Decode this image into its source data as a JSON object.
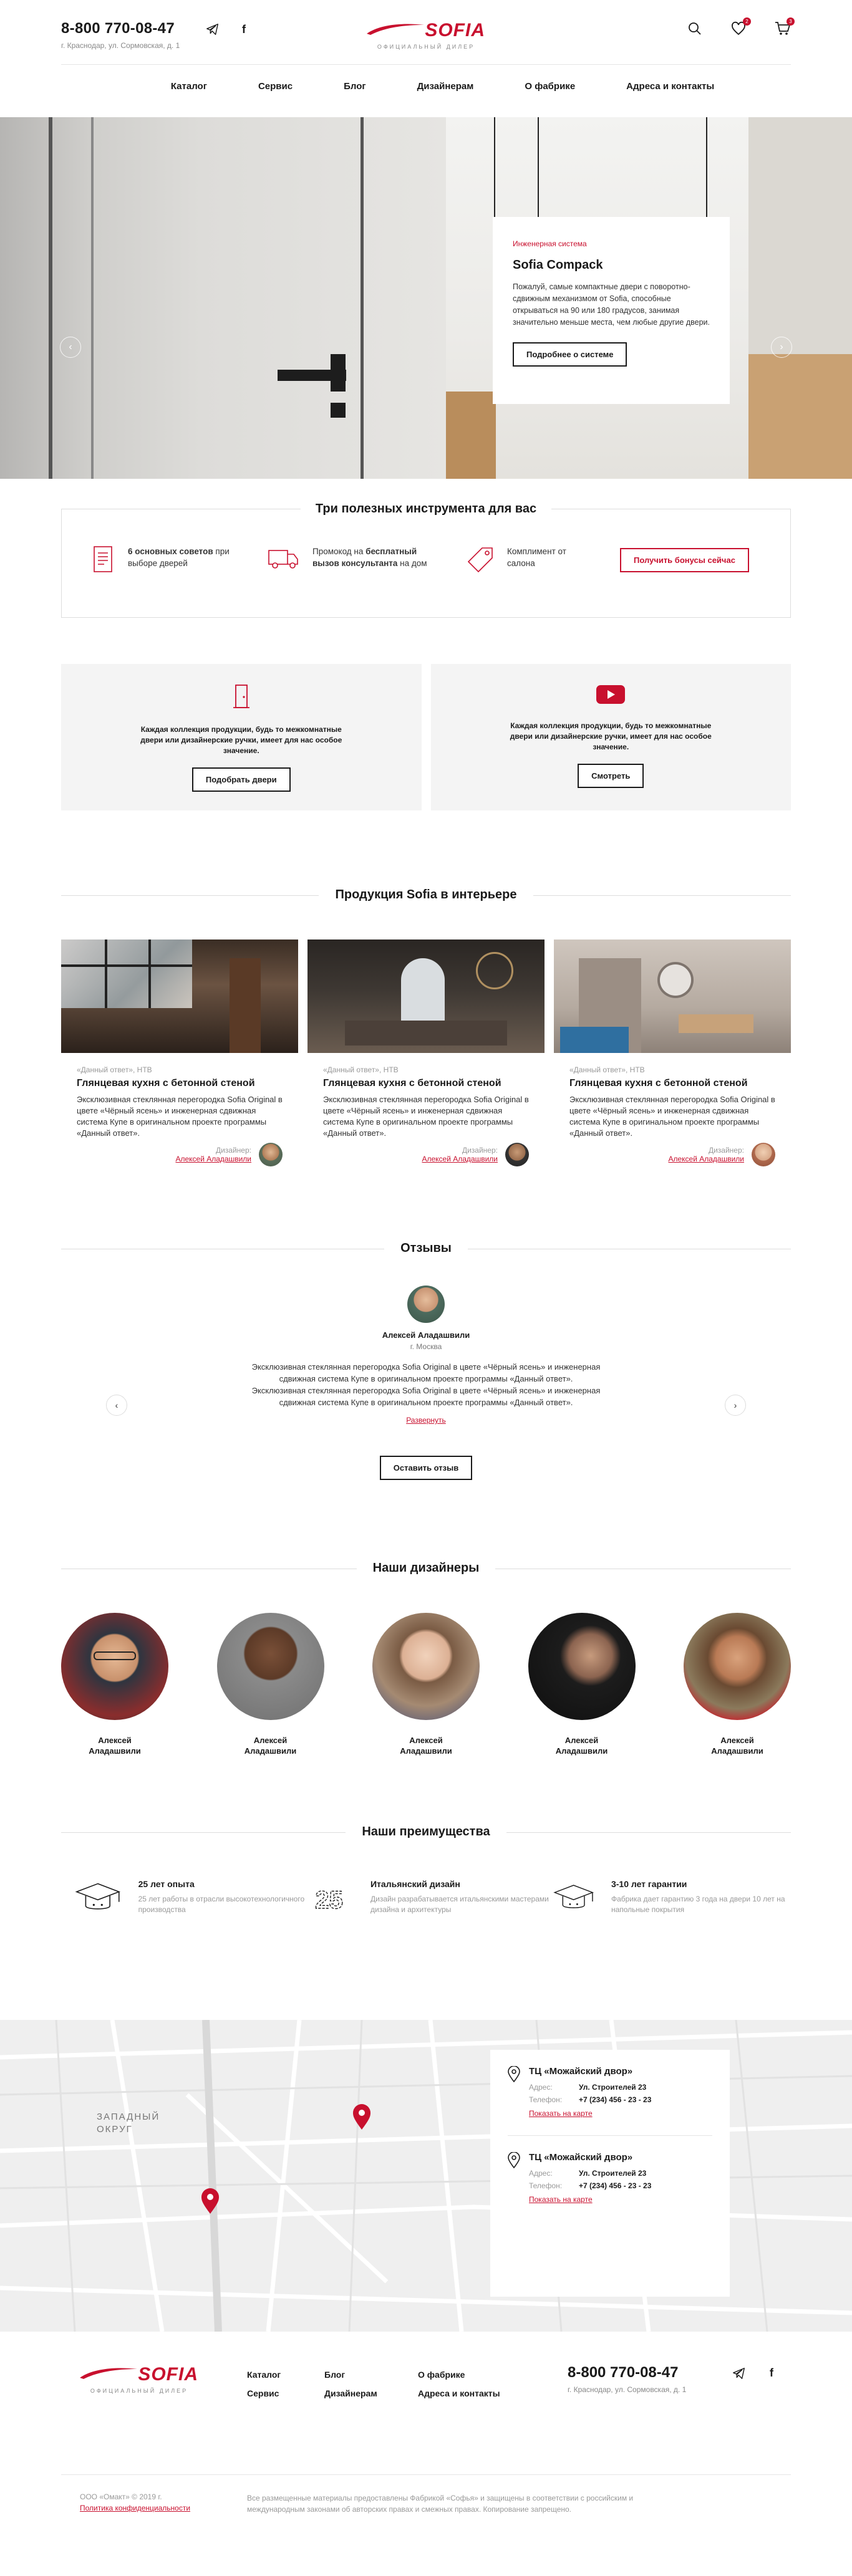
{
  "header": {
    "phone": "8-800 770-08-47",
    "address": "г. Краснодар, ул. Сормовская, д. 1",
    "logo_word": "SOFIA",
    "logo_sub": "ОФИЦИАЛЬНЫЙ ДИЛЕР",
    "wishlist_count": "2",
    "cart_count": "3",
    "nav": [
      "Каталог",
      "Сервис",
      "Блог",
      "Дизайнерам",
      "О фабрике",
      "Адреса и контакты"
    ]
  },
  "hero": {
    "kicker": "Инженерная система",
    "title": "Sofia Compack",
    "text": "Пожалуй, самые компактные двери с поворотно-сдвижным механизмом от Sofia, способные открываться на 90 или 180 градусов, занимая значительно меньше места, чем любые другие двери.",
    "button": "Подробнее о системе"
  },
  "tools": {
    "title": "Три полезных инструмента для вас",
    "t1_bold": "6 основных советов",
    "t1_text": " при выборе дверей",
    "t2_pre": "Промокод на ",
    "t2_bold": "бесплатный вызов консультанта",
    "t2_post": " на дом",
    "t3": "Комплимент от салона",
    "button": "Получить бонусы сейчас"
  },
  "promo_boxes": [
    {
      "text": "Каждая коллекция продукции, будь то межкомнатные двери или дизайнерские ручки, имеет для нас особое значение.",
      "button": "Подобрать двери"
    },
    {
      "text": "Каждая коллекция продукции, будь то межкомнатные двери или дизайнерские ручки, имеет для нас особое значение.",
      "button": "Смотреть"
    }
  ],
  "products": {
    "title": "Продукция Sofia в интерьере",
    "items": [
      {
        "tag": "«Данный ответ», НТВ",
        "title": "Глянцевая кухня с бетонной стеной",
        "text": "Эксклюзивная стеклянная перегородка Sofia Original в цвете «Чёрный ясень» и инженерная сдвижная система Купе в оригинальном проекте программы «Данный ответ».",
        "designer_label": "Дизайнер:",
        "designer": "Алексей Аладашвили"
      },
      {
        "tag": "«Данный ответ», НТВ",
        "title": "Глянцевая кухня с бетонной стеной",
        "text": "Эксклюзивная стеклянная перегородка Sofia Original в цвете «Чёрный ясень» и инженерная сдвижная система Купе в оригинальном проекте программы «Данный ответ».",
        "designer_label": "Дизайнер:",
        "designer": "Алексей Аладашвили"
      },
      {
        "tag": "«Данный ответ», НТВ",
        "title": "Глянцевая кухня с бетонной стеной",
        "text": "Эксклюзивная стеклянная перегородка Sofia Original в цвете «Чёрный ясень» и инженерная сдвижная система Купе в оригинальном проекте программы «Данный ответ».",
        "designer_label": "Дизайнер:",
        "designer": "Алексей Аладашвили"
      }
    ]
  },
  "reviews": {
    "title": "Отзывы",
    "name": "Алексей Аладашвили",
    "city": "г. Москва",
    "text": "Эксклюзивная стеклянная перегородка Sofia Original в цвете «Чёрный ясень» и инженерная сдвижная система Купе в оригинальном проекте программы «Данный ответ». Эксклюзивная стеклянная перегородка Sofia Original в цвете «Чёрный ясень» и инженерная сдвижная система Купе в оригинальном проекте программы «Данный ответ».",
    "more": "Развернуть",
    "button": "Оставить отзыв"
  },
  "designers": {
    "title": "Наши дизайнеры",
    "items": [
      {
        "first": "Алексей",
        "last": "Аладашвили"
      },
      {
        "first": "Алексей",
        "last": "Аладашвили"
      },
      {
        "first": "Алексей",
        "last": "Аладашвили"
      },
      {
        "first": "Алексей",
        "last": "Аладашвили"
      },
      {
        "first": "Алексей",
        "last": "Аладашвили"
      }
    ]
  },
  "advantages": {
    "title": "Наши преимущества",
    "items": [
      {
        "title": "25 лет опыта",
        "text": "25 лет работы в отрасли высокотехнологичного производства"
      },
      {
        "title": "Итальянский дизайн",
        "text": "Дизайн разрабатывается итальянскими мастерами дизайна и архитектуры"
      },
      {
        "title": "3-10 лет гарантии",
        "text": "Фабрика дает гарантию 3 года на двери 10 лет на напольные покрытия"
      }
    ]
  },
  "map": {
    "district": "ЗАПАДНЫЙ ОКРУГ",
    "locations": [
      {
        "name": "ТЦ «Можайский двор»",
        "addr_label": "Адрес:",
        "addr": "Ул. Строителей 23",
        "tel_label": "Телефон:",
        "tel": "+7 (234) 456 - 23 - 23",
        "link": "Показать на карте"
      },
      {
        "name": "ТЦ «Можайский двор»",
        "addr_label": "Адрес:",
        "addr": "Ул. Строителей 23",
        "tel_label": "Телефон:",
        "tel": "+7 (234) 456 - 23 - 23",
        "link": "Показать на карте"
      }
    ]
  },
  "footer": {
    "col1": [
      "Каталог",
      "Сервис"
    ],
    "col2": [
      "Блог",
      "Дизайнерам"
    ],
    "col3": [
      "О фабрике",
      "Адреса и контакты"
    ],
    "phone": "8-800 770-08-47",
    "address": "г. Краснодар, ул. Сормовская, д. 1",
    "copyright": "ООО «Омакт» © 2019 г.",
    "privacy": "Политика конфиденциальности",
    "legal": "Все размещенные материалы предоставлены Фабрикой «Софья» и защищены в соответствии с российским и международным законами об авторских правах и смежных правах. Копирование запрещено."
  }
}
